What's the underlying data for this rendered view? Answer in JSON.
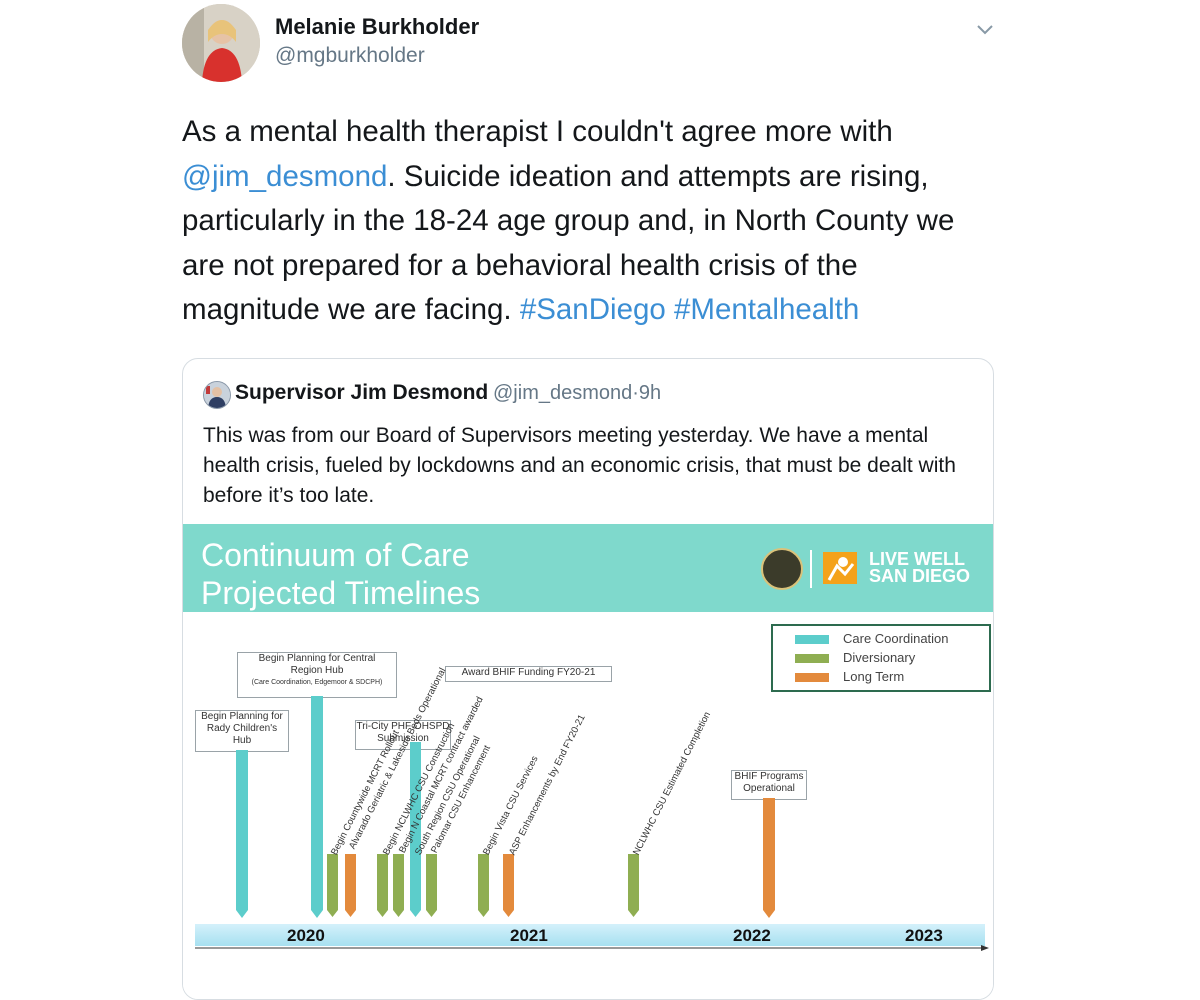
{
  "tweet": {
    "author_name": "Melanie Burkholder",
    "author_handle": "@mgburkholder",
    "text_part1": "As a mental health therapist I couldn't agree more with ",
    "mention": "@jim_desmond",
    "text_part2": ". Suicide ideation and attempts are rising, particularly in the 18-24 age group and, in North County we are not prepared for a behavioral health crisis of the magnitude we are facing. ",
    "hashtag1": "#SanDiego",
    "hashtag2": "#Mentalhealth"
  },
  "quoted": {
    "author_name": "Supervisor Jim Desmond",
    "author_handle": "@jim_desmond",
    "separator": "·",
    "time": "9h",
    "text": "This was from our Board of Supervisors meeting yesterday. We have a mental health crisis, fueled by lockdowns and an economic crisis, that must be dealt with before it’s too late."
  },
  "slide": {
    "title_line1": "Continuum of Care",
    "title_line2": "Projected Timelines",
    "logo_line1": "LIVE WELL",
    "logo_line2": "SAN DIEGO",
    "header_color": "#7fd9cc"
  },
  "chart_data": {
    "type": "bar",
    "title": "Continuum of Care Projected Timelines",
    "legend_position": "top-right",
    "series": [
      {
        "name": "Care Coordination",
        "color": "#5ccdcb"
      },
      {
        "name": "Diversionary",
        "color": "#8fae52"
      },
      {
        "name": "Long Term",
        "color": "#e38a3c"
      }
    ],
    "x_ticks": [
      "2020",
      "2021",
      "2022",
      "2023"
    ],
    "callouts": [
      {
        "text_line1": "Begin Planning for Central",
        "text_line2": "Region Hub",
        "text_line3": "(Care Coordination, Edgemoor & SDCPH)"
      },
      {
        "text_line1": "Begin Planning for",
        "text_line2": "Rady Children's",
        "text_line3": "Hub"
      },
      {
        "text_line1": "Award BHIF Funding FY20-21"
      },
      {
        "text_line1": "Tri-City PHF OHSPD",
        "text_line2": "Submission"
      },
      {
        "text_line1": "BHIF Programs",
        "text_line2": "Operational"
      }
    ],
    "milestones": [
      {
        "label": "Begin Countywide MCRT Rollout",
        "series": "Diversionary"
      },
      {
        "label": "Alvarado Geriatric & Lakeside Beds Operational",
        "series": "Long Term"
      },
      {
        "label": "Begin NCLWHC CSU Construction",
        "series": "Diversionary"
      },
      {
        "label": "Begin N Coastal MCRT contract awarded",
        "series": "Diversionary"
      },
      {
        "label": "South Region CSU Operational",
        "series": "Diversionary"
      },
      {
        "label": "Palomar CSU Enhancement",
        "series": "Diversionary"
      },
      {
        "label": "Begin Vista CSU Services",
        "series": "Diversionary"
      },
      {
        "label": "ASP Enhancements by End FY20-21",
        "series": "Long Term"
      },
      {
        "label": "NCLWHC CSU Estimated Completion",
        "series": "Diversionary"
      }
    ]
  }
}
